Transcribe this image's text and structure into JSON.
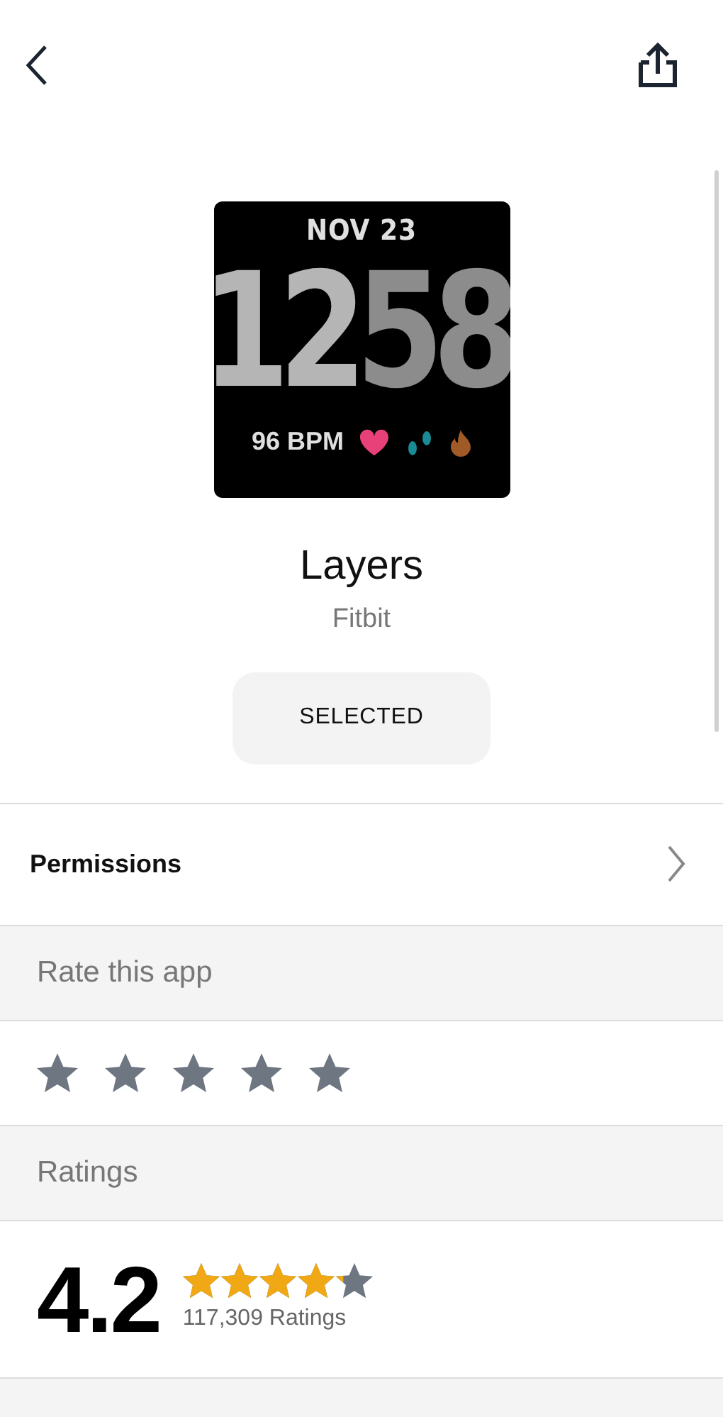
{
  "watch_face": {
    "date": "NOV 23",
    "hours": "12",
    "minutes": "58",
    "heart_rate": "96 BPM"
  },
  "app": {
    "name": "Layers",
    "developer": "Fitbit",
    "button": "SELECTED"
  },
  "permissions": {
    "label": "Permissions"
  },
  "rate": {
    "header": "Rate this app"
  },
  "ratings": {
    "header": "Ratings",
    "score": "4.2",
    "stars": 4.2,
    "count": "117,309 Ratings"
  }
}
